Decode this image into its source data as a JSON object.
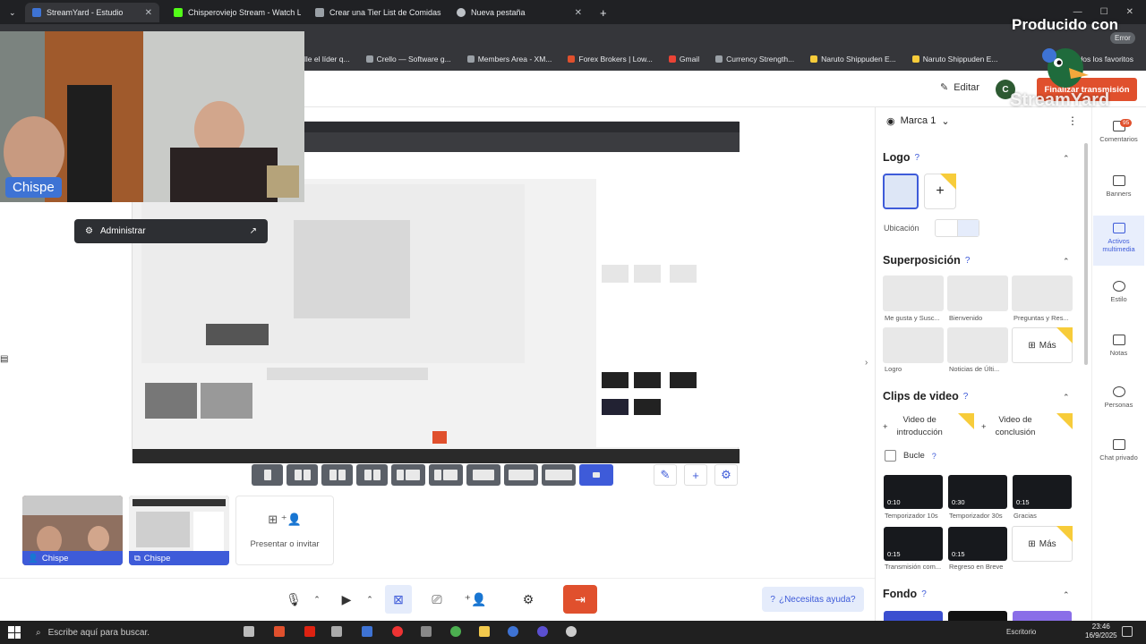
{
  "browser": {
    "tabs": [
      {
        "label": "StreamYard - Estudio",
        "active": true
      },
      {
        "label": "Chisperoviejo Stream - Watch L",
        "active": false
      },
      {
        "label": "Crear una Tier List de Comidas",
        "active": false
      },
      {
        "label": "Nueva pestaña",
        "active": false
      }
    ],
    "bookmarks": [
      "lle el líder q...",
      "Crello — Software g...",
      "Members Area - XM...",
      "Forex Brokers | Low...",
      "Gmail",
      "Currency Strength...",
      "Naruto Shippuden E...",
      "Naruto Shippuden E..."
    ],
    "all_bookmarks_label": "dos los favoritos",
    "error_label": "Error"
  },
  "watermark": {
    "line1": "Producido con",
    "line2": "StreamYard"
  },
  "header": {
    "edit_label": "Editar",
    "avatar_letter": "C",
    "finish_label": "Finalizar transmisión"
  },
  "webcam": {
    "name_tag": "Chispe"
  },
  "admin_popup": {
    "label": "Administrar"
  },
  "participants": [
    {
      "name": "Chispe"
    },
    {
      "name": "Chispe"
    }
  ],
  "invite": {
    "label": "Presentar o invitar"
  },
  "help": {
    "label": "¿Necesitas ayuda?"
  },
  "panel": {
    "brand": "Marca 1",
    "logo": {
      "title": "Logo",
      "location_label": "Ubicación"
    },
    "overlay": {
      "title": "Superposición",
      "items": [
        "Me gusta y Susc...",
        "Bienvenido",
        "Preguntas y Res...",
        "Logro",
        "Noticias de Últi..."
      ],
      "more_label": "Más"
    },
    "clips": {
      "title": "Clips de video",
      "intro_line1": "Video de",
      "intro_line2": "introducción",
      "outro_line1": "Video de",
      "outro_line2": "conclusión",
      "loop_label": "Bucle",
      "items": [
        {
          "duration": "0:10",
          "label": "Temporizador 10s"
        },
        {
          "duration": "0:30",
          "label": "Temporizador 30s"
        },
        {
          "duration": "0:15",
          "label": "Gracias"
        },
        {
          "duration": "0:15",
          "label": "Transmisión com..."
        },
        {
          "duration": "0:15",
          "label": "Regreso en Breve"
        }
      ],
      "more_label": "Más"
    },
    "background": {
      "title": "Fondo"
    }
  },
  "sidenav": [
    {
      "label": "Comentarios",
      "badge": "95"
    },
    {
      "label": "Banners"
    },
    {
      "label": "Activos multimedia",
      "selected": true
    },
    {
      "label": "Estilo"
    },
    {
      "label": "Notas"
    },
    {
      "label": "Personas"
    },
    {
      "label": "Chat privado"
    }
  ],
  "taskbar": {
    "search_placeholder": "Escribe aquí para buscar.",
    "desktop_label": "Escritorio",
    "time": "23:46",
    "date": "16/9/2025"
  },
  "colors": {
    "accent": "#3e5bd9",
    "finish": "#e0502d",
    "name_tag": "#3e73d4",
    "star": "#f7cc3a"
  }
}
